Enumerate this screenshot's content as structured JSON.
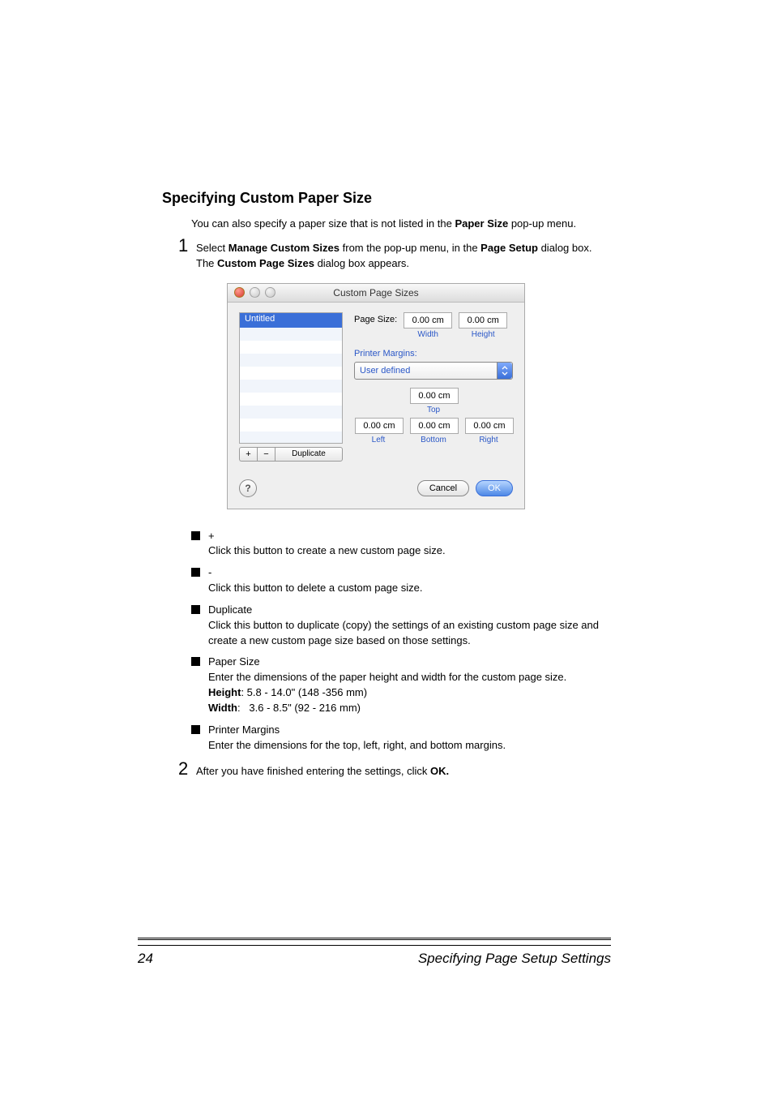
{
  "heading": "Specifying Custom Paper Size",
  "intro_pre": "You can also specify a paper size that is not listed in the ",
  "intro_bold": "Paper Size",
  "intro_post": " pop-up menu.",
  "step1": {
    "num": "1",
    "pre": "Select ",
    "bold1": "Manage Custom Sizes",
    "mid": " from the pop-up menu, in the ",
    "bold2": "Page Setup",
    "post": " dialog box.",
    "line2_pre": "The ",
    "line2_bold": "Custom Page Sizes",
    "line2_post": " dialog box appears."
  },
  "dialog": {
    "title": "Custom Page Sizes",
    "list_selected": "Untitled",
    "btn_plus": "+",
    "btn_minus": "−",
    "btn_duplicate": "Duplicate",
    "page_size_label": "Page Size:",
    "width_val": "0.00 cm",
    "width_label": "Width",
    "height_val": "0.00 cm",
    "height_label": "Height",
    "printer_margins_label": "Printer Margins:",
    "margins_select": "User defined",
    "top_val": "0.00 cm",
    "top_label": "Top",
    "left_val": "0.00 cm",
    "left_label": "Left",
    "right_val": "0.00 cm",
    "right_label": "Right",
    "bottom_val": "0.00 cm",
    "bottom_label": "Bottom",
    "help": "?",
    "cancel": "Cancel",
    "ok": "OK"
  },
  "bullets": {
    "b1_title": "+",
    "b1_body": "Click this button to create a new custom page size.",
    "b2_title": "-",
    "b2_body": "Click this button to delete a custom page size.",
    "b3_title": "Duplicate",
    "b3_body": "Click this button to duplicate (copy) the settings of an existing custom page size and create a new custom page size based on those settings.",
    "b4_title": "Paper Size",
    "b4_body": "Enter the dimensions of the paper height and width for the custom page size.",
    "b4_h_label": "Height",
    "b4_h_val": ": 5.8 - 14.0\" (148 -356 mm)",
    "b4_w_label": "Width",
    "b4_w_val": ":   3.6 - 8.5\" (92 - 216 mm)",
    "b5_title": "Printer Margins",
    "b5_body": "Enter the dimensions for the top, left, right, and bottom margins."
  },
  "step2": {
    "num": "2",
    "pre": "After you have finished entering the settings, click ",
    "bold": "OK."
  },
  "footer": {
    "page": "24",
    "title": "Specifying Page Setup Settings"
  }
}
